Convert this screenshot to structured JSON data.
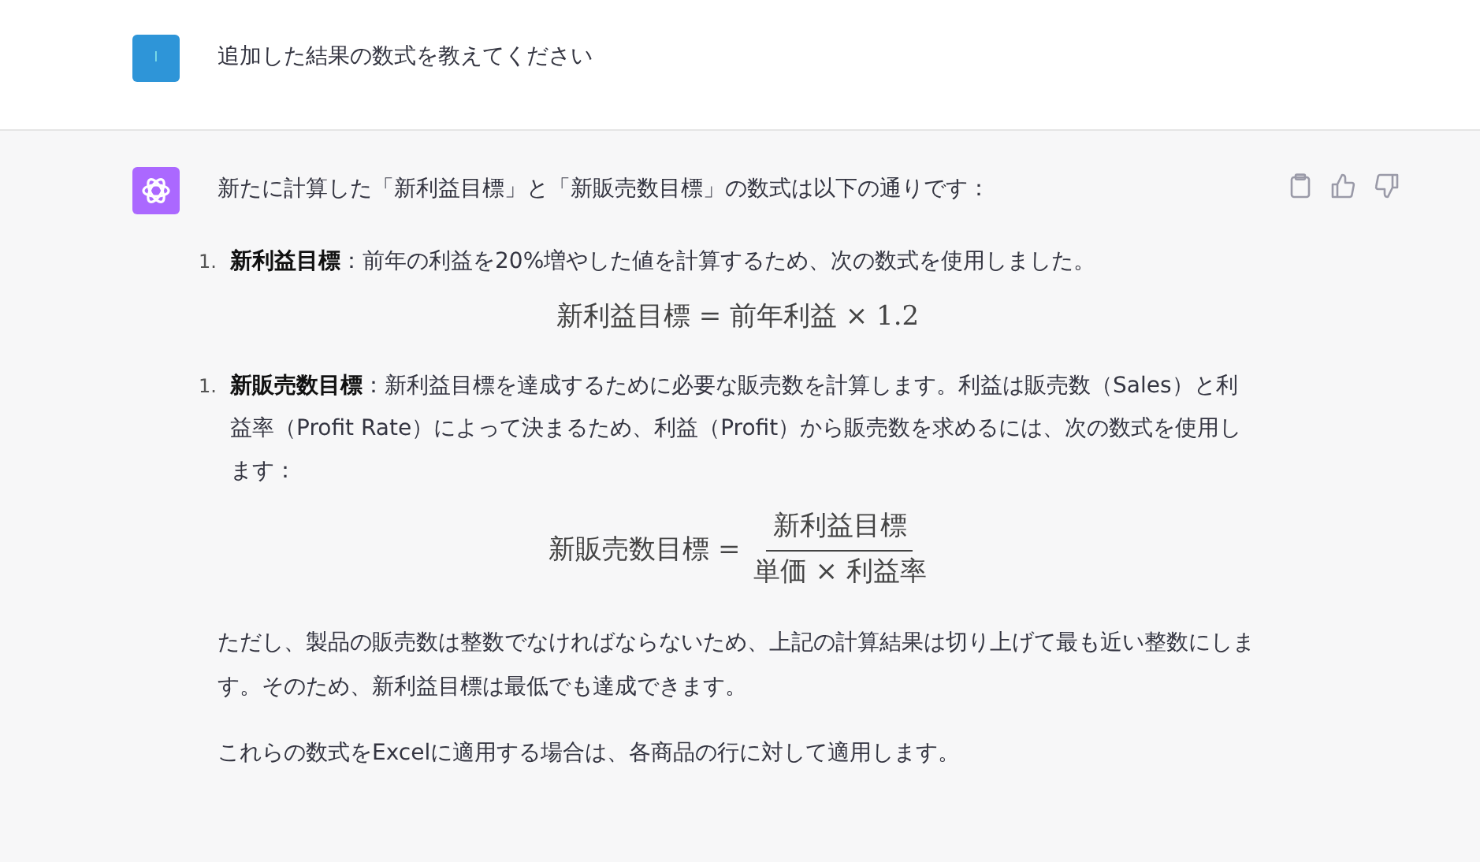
{
  "user_message": {
    "avatar": "I",
    "text": "追加した結果の数式を教えてください"
  },
  "assistant_message": {
    "intro": "新たに計算した「新利益目標」と「新販売数目標」の数式は以下の通りです：",
    "items": [
      {
        "number": "1.",
        "text": "**新利益目標**：前年の利益を20%増やした値を計算するため、次の数式を使用しました。",
        "formula": {
          "kind": "inline",
          "expression": "新利益目標 = 前年利益 × 1.2"
        }
      },
      {
        "number": "1.",
        "text": "**新販売数目標**：新利益目標を達成するために必要な販売数を計算します。利益は販売数（Sales）と利益率（Profit Rate）によって決まるため、利益（Profit）から販売数を求めるには、次の数式を使用します：",
        "formula": {
          "kind": "fraction",
          "lhs": "新販売数目標 =",
          "numerator": "新利益目標",
          "denominator": "単価 × 利益率"
        }
      }
    ],
    "paragraphs": [
      "ただし、製品の販売数は整数でなければならないため、上記の計算結果は切り上げて最も近い整数にします。そのため、新利益目標は最低でも達成できます。",
      "これらの数式をExcelに適用する場合は、各商品の行に対して適用します。"
    ]
  }
}
